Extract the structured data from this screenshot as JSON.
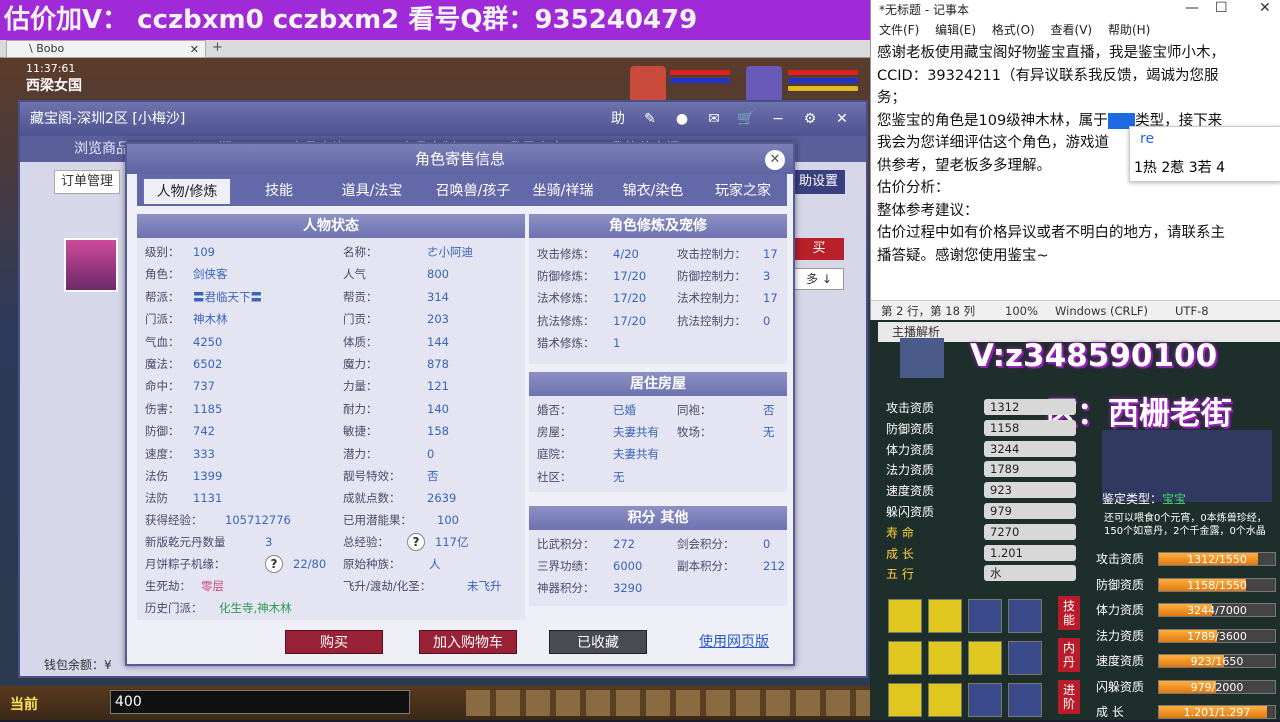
{
  "banner": {
    "text": "估价加V： cczbxm0 cczbxm2 看号Q群：935240479"
  },
  "game_tab": {
    "title": "\\ Bobo"
  },
  "scene": {
    "time": "11:37:61",
    "location": "西梁女国"
  },
  "cbg": {
    "title": "藏宝阁-深圳2区 [小梅沙]",
    "nav": [
      "浏览商品",
      "公示期",
      "商品查询",
      "商品定制",
      "我是卖家",
      "我的藏宝阁"
    ],
    "sub_left": "订单管理",
    "sub_right": "助设置",
    "buy_small": "买",
    "sort_small": "多 ↓",
    "wallet": "钱包余额：¥"
  },
  "dialog": {
    "title": "角色寄售信息",
    "tabs": [
      "人物/修炼",
      "技能",
      "道具/法宝",
      "召唤兽/孩子",
      "坐骑/祥瑞",
      "锦衣/染色",
      "玩家之家"
    ],
    "status_title": "人物状态",
    "status_left": [
      {
        "k": "级别：",
        "v": "109"
      },
      {
        "k": "角色：",
        "v": "剑侠客"
      },
      {
        "k": "帮派：",
        "v": "〓君临天下〓"
      },
      {
        "k": "门派：",
        "v": "神木林"
      },
      {
        "k": "气血：",
        "v": "4250"
      },
      {
        "k": "魔法：",
        "v": "6502"
      },
      {
        "k": "命中：",
        "v": "737"
      },
      {
        "k": "伤害：",
        "v": "1185"
      },
      {
        "k": "防御：",
        "v": "742"
      },
      {
        "k": "速度：",
        "v": "333"
      },
      {
        "k": "法伤",
        "v": "1399"
      },
      {
        "k": "法防",
        "v": "1131"
      }
    ],
    "status_right": [
      {
        "k": "名称：",
        "v": "ㄜ小阿迪"
      },
      {
        "k": "人气",
        "v": "800"
      },
      {
        "k": "帮贡：",
        "v": "314"
      },
      {
        "k": "门贡：",
        "v": "203"
      },
      {
        "k": "体质：",
        "v": "144"
      },
      {
        "k": "魔力：",
        "v": "878"
      },
      {
        "k": "力量：",
        "v": "121"
      },
      {
        "k": "耐力：",
        "v": "140"
      },
      {
        "k": "敏捷：",
        "v": "158"
      },
      {
        "k": "潜力：",
        "v": "0"
      },
      {
        "k": "靓号特效：",
        "v": "否"
      },
      {
        "k": "成就点数：",
        "v": "2639"
      }
    ],
    "extra": [
      {
        "k": "获得经验：",
        "v": "105712776"
      },
      {
        "k": "已用潜能果：",
        "v": "100"
      },
      {
        "k": "新版乾元丹数量",
        "v": "3"
      },
      {
        "k": "总经验：",
        "v": "117亿"
      },
      {
        "k": "月饼粽子机缘：",
        "v": "22/80"
      },
      {
        "k": "原始种族：",
        "v": "人"
      },
      {
        "k": "生死劫：",
        "v": "零层"
      },
      {
        "k": "飞升/渡劫/化圣：",
        "v": "未飞升"
      },
      {
        "k": "历史门派：",
        "v": "化生寺,神木林"
      }
    ],
    "cult_title": "角色修炼及宠修",
    "cult": [
      {
        "k": "攻击修炼：",
        "v": "4/20",
        "k2": "攻击控制力：",
        "v2": "17"
      },
      {
        "k": "防御修炼：",
        "v": "17/20",
        "k2": "防御控制力：",
        "v2": "3"
      },
      {
        "k": "法术修炼：",
        "v": "17/20",
        "k2": "法术控制力：",
        "v2": "17"
      },
      {
        "k": "抗法修炼：",
        "v": "17/20",
        "k2": "抗法控制力：",
        "v2": "0"
      },
      {
        "k": "猎术修炼：",
        "v": "1",
        "k2": "",
        "v2": ""
      }
    ],
    "house_title": "居住房屋",
    "house": [
      {
        "k": "婚否：",
        "v": "已婚",
        "k2": "同袍：",
        "v2": "否"
      },
      {
        "k": "房屋：",
        "v": "夫妻共有",
        "k2": "牧场：",
        "v2": "无"
      },
      {
        "k": "庭院：",
        "v": "夫妻共有",
        "k2": "",
        "v2": ""
      },
      {
        "k": "社区：",
        "v": "无",
        "k2": "",
        "v2": ""
      }
    ],
    "score_title": "积分 其他",
    "score": [
      {
        "k": "比武积分：",
        "v": "272",
        "k2": "剑会积分：",
        "v2": "0"
      },
      {
        "k": "三界功绩：",
        "v": "6000",
        "k2": "副本积分：",
        "v2": "212"
      },
      {
        "k": "神器积分：",
        "v": "3290",
        "k2": "",
        "v2": ""
      }
    ],
    "buttons": {
      "buy": "购买",
      "cart": "加入购物车",
      "fav": "已收藏",
      "web": "使用网页版"
    }
  },
  "bottombar": {
    "current": "当前",
    "input": "400"
  },
  "notepad": {
    "title": "*无标题 - 记事本",
    "menu": [
      "文件(F)",
      "编辑(E)",
      "格式(O)",
      "查看(V)",
      "帮助(H)"
    ],
    "lines": [
      "感谢老板使用藏宝阁好物鉴宝直播，我是鉴宝师小木，",
      "CCID：39324211（有异议联系我反馈，竭诚为您服",
      "务；",
      "您鉴宝的角色是109级神木林，属于",
      "我会为您详细评估这个角色，游戏道",
      "供参考，望老板多多理解。",
      "估价分析：",
      "整体参考建议：",
      "估价过程中如有价格异议或者不明白的地方，请联系主",
      "播答疑。感谢您使用鉴宝~"
    ],
    "line4_tail": "类型，接下来",
    "ime_input": "re",
    "ime_cands": "1热 2惹 3若 4",
    "status": {
      "pos": "第 2 行，第 18 列",
      "zoom": "100%",
      "eol": "Windows (CRLF)",
      "enc": "UTF-8"
    }
  },
  "right_panel": {
    "tab": "主播解析",
    "wechat": "V:z348590100",
    "region": "区：西栅老街",
    "aptitudes": [
      {
        "k": "攻击资质",
        "v": "1312"
      },
      {
        "k": "防御资质",
        "v": "1158"
      },
      {
        "k": "体力资质",
        "v": "3244"
      },
      {
        "k": "法力资质",
        "v": "1789"
      },
      {
        "k": "速度资质",
        "v": "923"
      },
      {
        "k": "躲闪资质",
        "v": "979"
      },
      {
        "k": "寿    命",
        "v": "7270"
      },
      {
        "k": "成    长",
        "v": "1.201"
      },
      {
        "k": "五    行",
        "v": "水"
      }
    ],
    "jianding_label": "鉴定类型：",
    "jianding_value": "宝宝",
    "note": "还可以喂食0个元宵，0本炼兽珍经，150个如意丹，2个千金露，0个水晶糕",
    "side_labels": [
      "技能",
      "内丹",
      "进阶"
    ],
    "bars": [
      {
        "k": "攻击资质",
        "v": "1312/1550",
        "pct": 0.846
      },
      {
        "k": "防御资质",
        "v": "1158/1550",
        "pct": 0.747
      },
      {
        "k": "体力资质",
        "v": "3244/7000",
        "pct": 0.463
      },
      {
        "k": "法力资质",
        "v": "1789/3600",
        "pct": 0.497
      },
      {
        "k": "速度资质",
        "v": "923/1650",
        "pct": 0.559
      },
      {
        "k": "闪躲资质",
        "v": "979/2000",
        "pct": 0.49
      },
      {
        "k": "成    长",
        "v": "1.201/1.297",
        "pct": 0.926
      }
    ]
  }
}
